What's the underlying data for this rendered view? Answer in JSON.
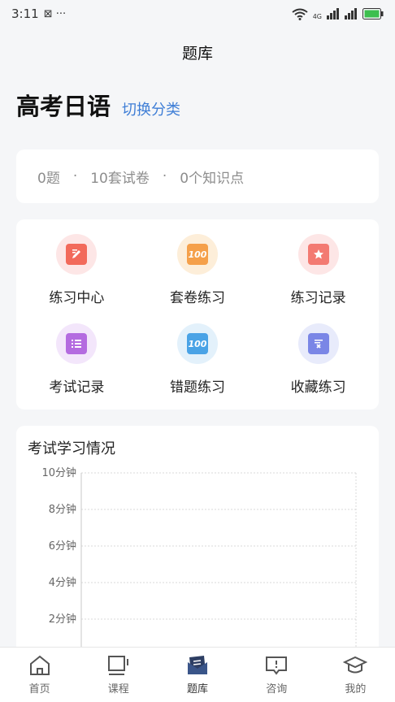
{
  "status_bar": {
    "time": "3:11",
    "extra": "⊠ ···",
    "network": "4G"
  },
  "nav": {
    "title": "题库"
  },
  "subject": {
    "title": "高考日语",
    "switch_label": "切换分类"
  },
  "stats": {
    "questions": "0题",
    "papers": "10套试卷",
    "knowledge_points": "0个知识点",
    "separator": "·"
  },
  "grid": {
    "items": [
      {
        "label": "练习中心",
        "icon": "practice-center-icon",
        "bg": "#fde6e6",
        "fg": "#f26a5b"
      },
      {
        "label": "套卷练习",
        "icon": "paper-set-icon",
        "bg": "#fdeed9",
        "fg": "#f5a04a"
      },
      {
        "label": "练习记录",
        "icon": "practice-record-icon",
        "bg": "#fde6e6",
        "fg": "#f37a72"
      },
      {
        "label": "考试记录",
        "icon": "exam-record-icon",
        "bg": "#f3e6fb",
        "fg": "#b46be0"
      },
      {
        "label": "错题练习",
        "icon": "wrong-question-icon",
        "bg": "#e3f1fb",
        "fg": "#4aa3e6"
      },
      {
        "label": "收藏练习",
        "icon": "favorite-practice-icon",
        "bg": "#e8ebfb",
        "fg": "#7a86e6"
      }
    ]
  },
  "chart_data": {
    "type": "line",
    "title": "考试学习情况",
    "yticks": [
      "10分钟",
      "8分钟",
      "6分钟",
      "4分钟",
      "2分钟"
    ],
    "ylim": [
      0,
      10
    ],
    "series": [],
    "grid": true
  },
  "tabs": [
    {
      "label": "首页",
      "icon": "home-icon",
      "active": false
    },
    {
      "label": "课程",
      "icon": "course-icon",
      "active": false
    },
    {
      "label": "题库",
      "icon": "question-bank-icon",
      "active": true
    },
    {
      "label": "咨询",
      "icon": "consult-icon",
      "active": false
    },
    {
      "label": "我的",
      "icon": "profile-icon",
      "active": false
    }
  ],
  "colors": {
    "accent": "#3f7ed6",
    "background": "#f5f6f8"
  }
}
